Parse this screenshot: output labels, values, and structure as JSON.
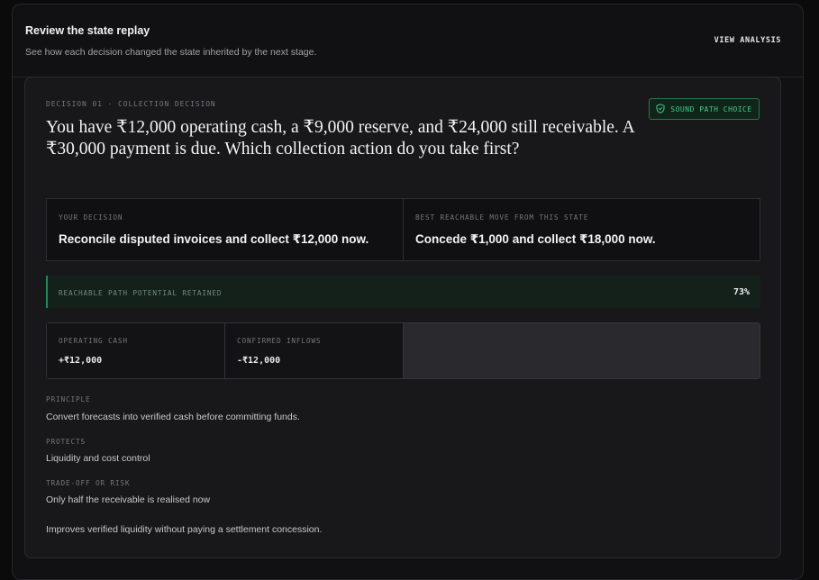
{
  "header": {
    "title": "Review the state replay",
    "subtitle": "See how each decision changed the state inherited by the next stage.",
    "view_button": "VIEW ANALYSIS"
  },
  "decision": {
    "eyebrow": "DECISION 01 · COLLECTION DECISION",
    "badge": "SOUND PATH CHOICE",
    "question": "You have ₹12,000 operating cash, a ₹9,000 reserve, and ₹24,000 still receivable. A ₹30,000 payment is due. Which collection action do you take first?",
    "your_decision_label": "YOUR DECISION",
    "your_decision": "Reconcile disputed invoices and collect ₹12,000 now.",
    "best_move_label": "BEST REACHABLE MOVE FROM THIS STATE",
    "best_move": "Concede ₹1,000 and collect ₹18,000 now.",
    "retained_label": "REACHABLE PATH POTENTIAL RETAINED",
    "retained_value": "73%",
    "metrics": [
      {
        "label": "OPERATING CASH",
        "value": "+₹12,000"
      },
      {
        "label": "CONFIRMED INFLOWS",
        "value": "-₹12,000"
      }
    ],
    "principle_label": "PRINCIPLE",
    "principle": "Convert forecasts into verified cash before committing funds.",
    "protects_label": "PROTECTS",
    "protects": "Liquidity and cost control",
    "tradeoff_label": "TRADE-OFF OR RISK",
    "tradeoff": "Only half the receivable is realised now",
    "summary": "Improves verified liquidity without paying a settlement concession."
  },
  "icons": {
    "badge_icon": "shield-check-icon"
  },
  "colors": {
    "accent_green": "#3fcf8a",
    "badge_border": "#1f7a4d"
  }
}
